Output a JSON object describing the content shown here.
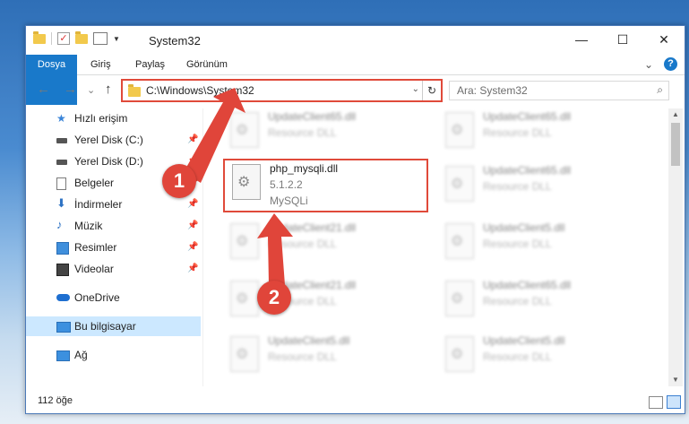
{
  "titlebar": {
    "title": "System32",
    "minimize": "—",
    "maximize": "☐",
    "close": "✕"
  },
  "ribbon": {
    "tabs": [
      "Dosya",
      "Giriş",
      "Paylaş",
      "Görünüm"
    ],
    "expand": "⌄",
    "help": "?"
  },
  "navbar": {
    "back": "←",
    "forward": "→",
    "recent": "⌄",
    "up": "↑",
    "address": "C:\\Windows\\System32",
    "address_dropdown": "⌄",
    "refresh": "↻",
    "search_placeholder": "Ara: System32",
    "search_icon": "⌕"
  },
  "sidebar": {
    "items": [
      {
        "label": "Hızlı erişim",
        "icon": "star-icon"
      },
      {
        "label": "Yerel Disk (C:)",
        "icon": "drive-icon"
      },
      {
        "label": "Yerel Disk (D:)",
        "icon": "drive-icon"
      },
      {
        "label": "Belgeler",
        "icon": "document-icon"
      },
      {
        "label": "İndirmeler",
        "icon": "download-icon"
      },
      {
        "label": "Müzik",
        "icon": "music-icon"
      },
      {
        "label": "Resimler",
        "icon": "pictures-icon"
      },
      {
        "label": "Videolar",
        "icon": "video-icon"
      },
      {
        "label": "OneDrive",
        "icon": "cloud-icon"
      },
      {
        "label": "Bu bilgisayar",
        "icon": "computer-icon"
      },
      {
        "label": "Ağ",
        "icon": "network-icon"
      }
    ],
    "pin": "📌"
  },
  "files": [
    {
      "name": "UpdateClient65.dll",
      "line2": "Resource DLL",
      "line3": ""
    },
    {
      "name": "UpdateClient65.dll",
      "line2": "Resource DLL",
      "line3": ""
    },
    {
      "name": "php_mysqli.dll",
      "line2": "5.1.2.2",
      "line3": "MySQLi"
    },
    {
      "name": "UpdateClient65.dll",
      "line2": "Resource DLL",
      "line3": ""
    },
    {
      "name": "UpdateClient21.dll",
      "line2": "Resource DLL",
      "line3": ""
    },
    {
      "name": "UpdateClient5.dll",
      "line2": "Resource DLL",
      "line3": ""
    },
    {
      "name": "UpdateClient21.dll",
      "line2": "Resource DLL",
      "line3": ""
    },
    {
      "name": "UpdateClient65.dll",
      "line2": "Resource DLL",
      "line3": ""
    },
    {
      "name": "UpdateClient65.dll",
      "line2": "Resource DLL",
      "line3": ""
    },
    {
      "name": "UpdateClient65.dll",
      "line2": "Resource DLL",
      "line3": ""
    },
    {
      "name": "UpdateClient5.dll",
      "line2": "Resource DLL",
      "line3": ""
    },
    {
      "name": "UpdateClient5.dll",
      "line2": "Resource DLL",
      "line3": ""
    }
  ],
  "statusbar": {
    "count": "112 öğe"
  },
  "annotations": {
    "step1": "1",
    "step2": "2",
    "color": "#e0453a"
  }
}
